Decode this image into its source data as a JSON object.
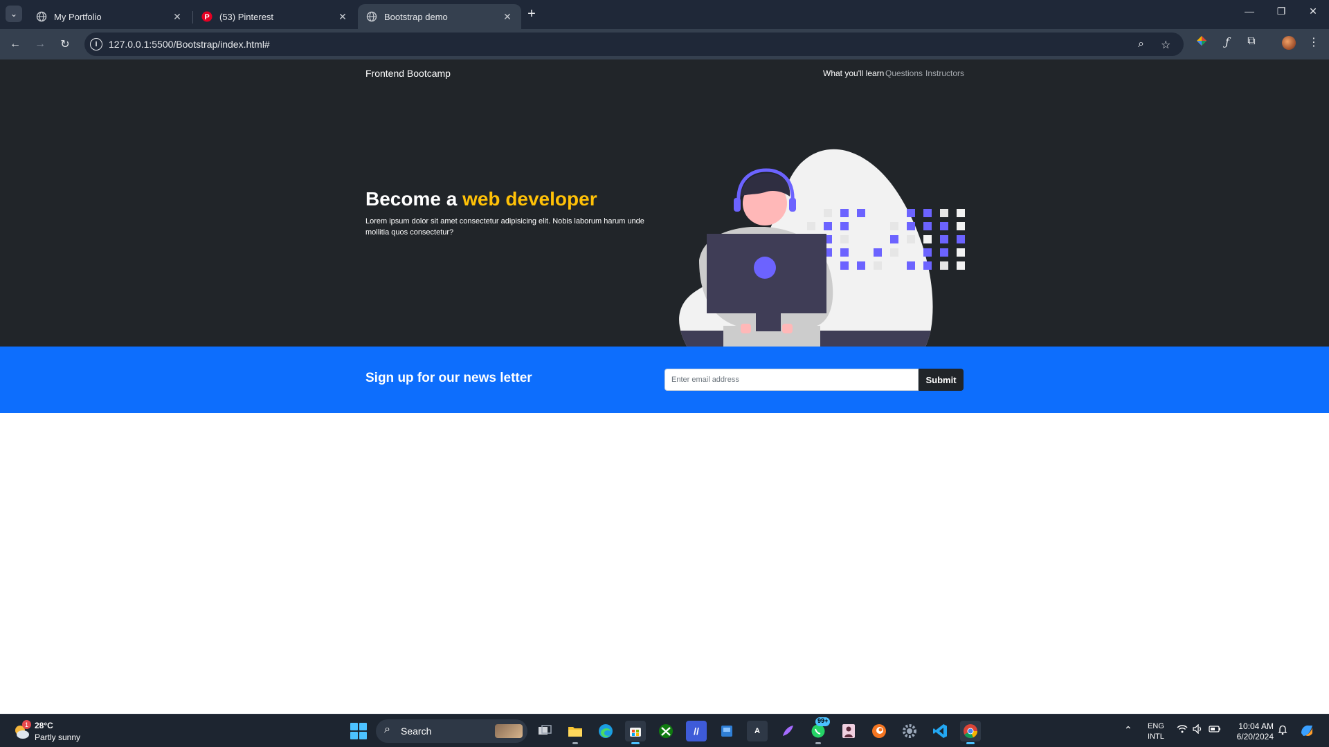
{
  "browser": {
    "tabs": [
      {
        "title": "My Portfolio",
        "active": false
      },
      {
        "title": "(53) Pinterest",
        "active": false
      },
      {
        "title": "Bootstrap demo",
        "active": true
      }
    ],
    "tab_close_glyph": "✕",
    "new_tab_glyph": "+",
    "url": "127.0.0.1:5500/Bootstrap/index.html#",
    "icons": {
      "back": "arrow-left-icon",
      "forward": "arrow-right-icon",
      "reload": "reload-icon",
      "site_info": "info-icon",
      "zoom": "zoom-icon",
      "bookmark": "star-icon"
    }
  },
  "page": {
    "navbar": {
      "brand": "Frontend Bootcamp",
      "links": [
        "What you'll learn",
        "Questions",
        "Instructors"
      ]
    },
    "hero": {
      "title_prefix": "Become a ",
      "title_accent": "web developer",
      "text": "Lorem ipsum dolor sit amet consectetur adipisicing elit. Nobis laborum harum unde mollitia quos consectetur?"
    },
    "newsletter": {
      "title": "Sign up for our news letter",
      "input_placeholder": "Enter email address",
      "input_value": "",
      "button_label": "Submit"
    },
    "colors": {
      "dark_bg": "#212529",
      "primary": "#0d6efd",
      "accent": "#ffc107",
      "illustration_purple": "#6c63ff"
    }
  },
  "taskbar": {
    "weather": {
      "temp": "28°C",
      "desc": "Partly sunny",
      "badge": "1"
    },
    "search_label": "Search",
    "whatsapp_badge": "99+",
    "lang": {
      "line1": "ENG",
      "line2": "INTL"
    },
    "clock": {
      "time": "10:04 AM",
      "date": "6/20/2024"
    }
  }
}
